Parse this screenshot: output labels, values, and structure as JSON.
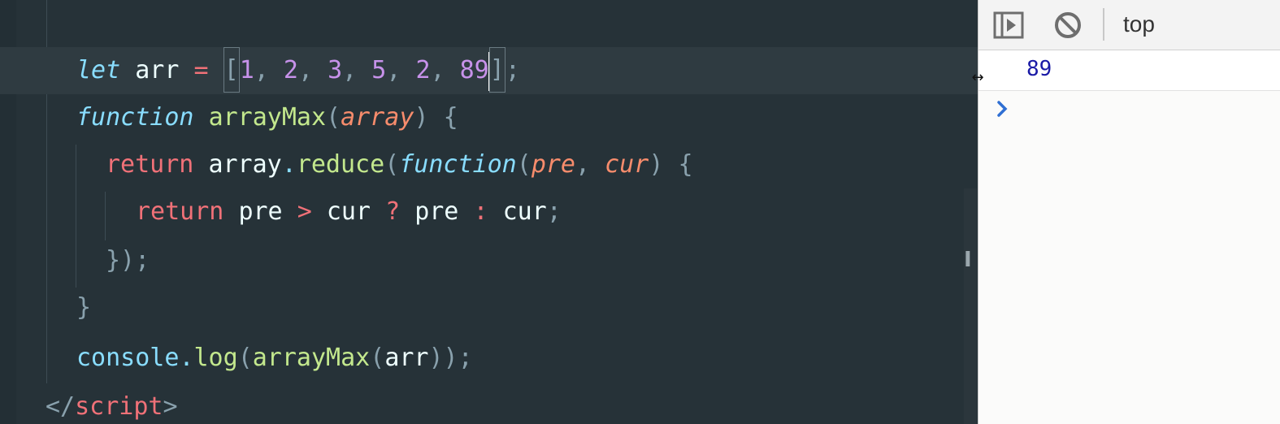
{
  "editor": {
    "lines": {
      "l1": {
        "kw": "let",
        "var": "arr",
        "op": "=",
        "open": "[",
        "n1": "1",
        "n2": "2",
        "n3": "3",
        "n4": "5",
        "n5": "2",
        "n6": "89",
        "close": "]",
        "end": ";"
      },
      "l2": {
        "kw": "function",
        "name": "arrayMax",
        "paren_open": "(",
        "param": "array",
        "paren_close": ")",
        "brace": "{"
      },
      "l3": {
        "kw": "return",
        "obj": "array",
        "dot": ".",
        "method": "reduce",
        "paren_open": "(",
        "fkw": "function",
        "paren_open2": "(",
        "p1": "pre",
        "comma": ",",
        "p2": "cur",
        "paren_close": ")",
        "brace": "{"
      },
      "l4": {
        "kw": "return",
        "a": "pre",
        "gt": ">",
        "b": "cur",
        "q": "?",
        "c": "pre",
        "colon": ":",
        "d": "cur",
        "end": ";"
      },
      "l5": {
        "text": "});"
      },
      "l6": {
        "text": "}"
      },
      "l7": {
        "obj": "console",
        "dot": ".",
        "method": "log",
        "p_open": "(",
        "fn": "arrayMax",
        "p_open2": "(",
        "arg": "arr",
        "p_close": "))",
        "end": ";"
      },
      "l8": {
        "open": "</",
        "tag": "script",
        "close": ">"
      }
    }
  },
  "devtools": {
    "toolbar": {
      "sidebar_toggle_icon": "sidebar-toggle-icon",
      "clear_icon": "clear-console-icon",
      "context": "top"
    },
    "console": {
      "output_value": "89",
      "prompt_icon": "chevron-right-icon"
    }
  },
  "colors": {
    "editor_bg": "#263238",
    "keyword": "#89ddff",
    "return": "#f07178",
    "number": "#c792ea",
    "function_name": "#c3e88d",
    "param": "#f78c6c",
    "console_value": "#1a1aa6",
    "prompt": "#2f6fd3"
  }
}
